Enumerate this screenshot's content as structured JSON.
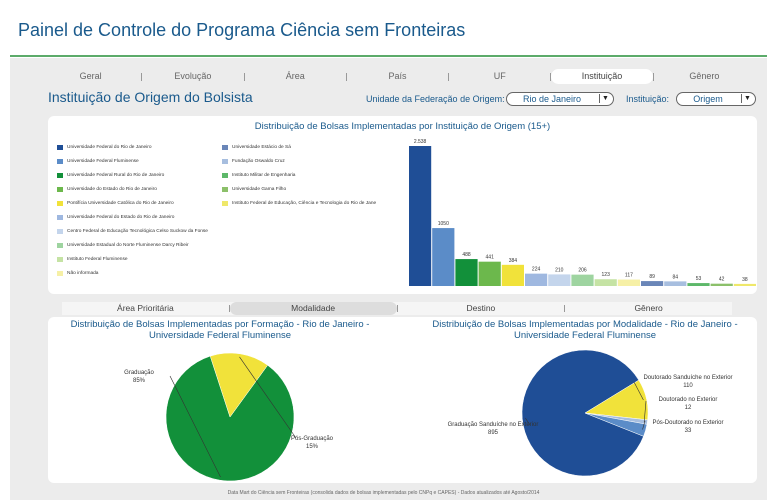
{
  "page": {
    "title": "Painel de Controle do Programa Ciência sem Fronteiras"
  },
  "nav": {
    "tabs": [
      "Geral",
      "Evolução",
      "Área",
      "País",
      "UF",
      "Instituição",
      "Gênero"
    ],
    "active": "Instituição"
  },
  "section": {
    "title": "Instituição de Origem do Bolsista"
  },
  "filters": {
    "uf_label": "Unidade da Federação de Origem:",
    "uf_value": "Rio de Janeiro",
    "inst_label": "Instituição:",
    "inst_value": "Origem"
  },
  "bar_chart": {
    "title": "Distribuição de Bolsas Implementadas por Instituição de Origem (15+)",
    "legend": [
      {
        "label": "Universidade Federal do Rio de Janeiro",
        "color": "#1f4e96"
      },
      {
        "label": "Universidade Federal Fluminense",
        "color": "#5b8cc8"
      },
      {
        "label": "Universidade Federal Rural do Rio de Janeiro",
        "color": "#12903a"
      },
      {
        "label": "Universidade do Estado do Rio de Janeiro",
        "color": "#6cb84c"
      },
      {
        "label": "Pontifícia Universidade Católica do Rio de Janeiro",
        "color": "#f1e23a"
      },
      {
        "label": "Universidade Federal do Estado do Rio de Janeiro",
        "color": "#9fb8e0"
      },
      {
        "label": "Centro Federal de Educação Tecnológica Celso Suckow da Fonse",
        "color": "#c4d5ec"
      },
      {
        "label": "Universidade Estadual do Norte Fluminense Darcy Ribeir",
        "color": "#9ed4a0"
      },
      {
        "label": "Instituto Federal Fluminense",
        "color": "#c5e3a4"
      },
      {
        "label": "Não informada",
        "color": "#f6f0a6"
      },
      {
        "label": "Universidade Estácio de Sá",
        "color": "#6a86b8"
      },
      {
        "label": "Fundação Oswaldo Cruz",
        "color": "#a7bedf"
      },
      {
        "label": "Instituto Militar de Engenharia",
        "color": "#5db86a"
      },
      {
        "label": "Universidade Gama Filho",
        "color": "#8cc06a"
      },
      {
        "label": "Instituto Federal de Educação, Ciência e Tecnologia do Rio de Jane",
        "color": "#efe86a"
      }
    ]
  },
  "chart_data": [
    {
      "type": "bar",
      "title": "Distribuição de Bolsas Implementadas por Instituição de Origem (15+)",
      "categories": [
        "Universidade Federal do Rio de Janeiro",
        "Universidade Federal Fluminense",
        "Universidade Federal Rural do Rio de Janeiro",
        "Universidade do Estado do Rio de Janeiro",
        "Pontifícia Universidade Católica do Rio de Janeiro",
        "Universidade Federal do Estado do Rio de Janeiro",
        "Centro Federal de Educação Tecnológica Celso Suckow da Fonse",
        "Universidade Estadual do Norte Fluminense Darcy Ribeir",
        "Instituto Federal Fluminense",
        "Não informada",
        "Universidade Estácio de Sá",
        "Fundação Oswaldo Cruz",
        "Instituto Militar de Engenharia",
        "Universidade Gama Filho",
        "Instituto Federal de Educação, Ciência e Tecnologia do Rio de Jane"
      ],
      "labels": [
        "2.538",
        "1050",
        "488",
        "441",
        "384",
        "224",
        "210",
        "206",
        "123",
        "117",
        "89",
        "84",
        "53",
        "42",
        "38"
      ],
      "values": [
        2538,
        1050,
        488,
        441,
        384,
        224,
        210,
        206,
        123,
        117,
        89,
        84,
        53,
        42,
        38
      ],
      "colors": [
        "#1f4e96",
        "#5b8cc8",
        "#12903a",
        "#6cb84c",
        "#f1e23a",
        "#9fb8e0",
        "#c4d5ec",
        "#9ed4a0",
        "#c5e3a4",
        "#f6f0a6",
        "#6a86b8",
        "#a7bedf",
        "#5db86a",
        "#8cc06a",
        "#efe86a"
      ]
    },
    {
      "type": "pie",
      "title": "Distribuição de Bolsas Implementadas por Formação - Rio de Janeiro - Universidade Federal Fluminense",
      "slices": [
        {
          "label": "Graduação",
          "value": 85,
          "value_text": "85%",
          "color": "#12903a"
        },
        {
          "label": "Pós-Graduação",
          "value": 15,
          "value_text": "15%",
          "color": "#f1e23a"
        }
      ]
    },
    {
      "type": "pie",
      "title": "Distribuição de Bolsas Implementadas por Modalidade - Rio de Janeiro - Universidade Federal Fluminense",
      "slices": [
        {
          "label": "Graduação Sanduíche no Exterior",
          "value": 895,
          "value_text": "895",
          "color": "#1f4e96"
        },
        {
          "label": "Doutorado Sanduíche no Exterior",
          "value": 110,
          "value_text": "110",
          "color": "#f1e23a"
        },
        {
          "label": "Doutorado no Exterior",
          "value": 12,
          "value_text": "12",
          "color": "#a7bedf"
        },
        {
          "label": "Pós-Doutorado no Exterior",
          "value": 33,
          "value_text": "33",
          "color": "#5b8cc8"
        }
      ]
    }
  ],
  "lower_tabs": {
    "tabs": [
      "Área Prioritária",
      "Modalidade",
      "Destino",
      "Gênero"
    ],
    "active": "Modalidade"
  },
  "pie1": {
    "title": "Distribuição de Bolsas Implementadas por Formação - Rio de Janeiro - Universidade Federal Fluminense"
  },
  "pie2": {
    "title": "Distribuição de Bolsas Implementadas por Modalidade - Rio de Janeiro - Universidade Federal Fluminense"
  },
  "footer": {
    "text": "Data Mart do Ciência sem Fronteiras (consolida dados de bolsas implementadas pelo CNPq e CAPES) - Dados atualizados até Agosto/2014"
  }
}
